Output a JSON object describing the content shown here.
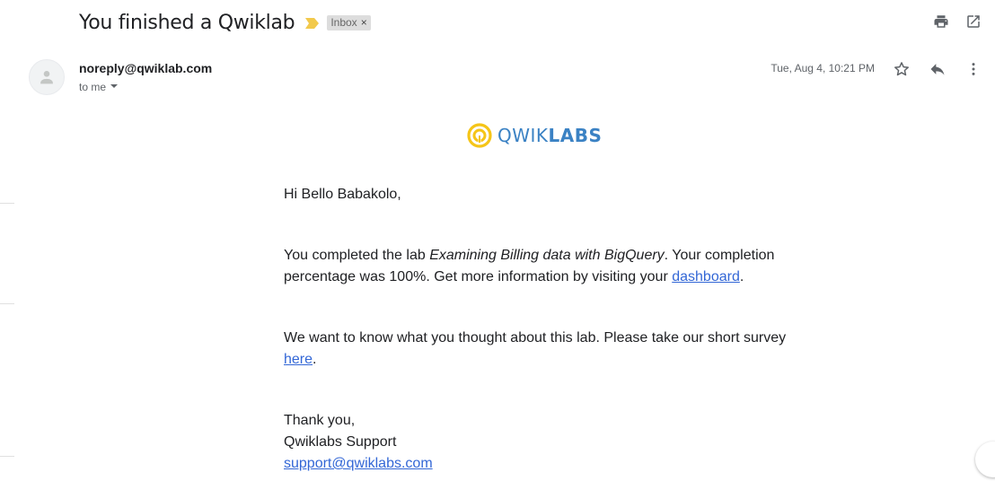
{
  "email": {
    "subject": "You finished a Qwiklab",
    "label": "Inbox",
    "label_close": "×",
    "sender": "noreply@qwiklab.com",
    "to": "to me",
    "date": "Tue, Aug 4, 10:21 PM"
  },
  "icons": {
    "print": "print-icon",
    "open_new_window": "open-in-new-window-icon",
    "importance": "importance-marker-icon",
    "star": "star-icon",
    "reply": "reply-icon",
    "more": "more-vertical-icon",
    "avatar": "avatar-icon",
    "dropdown": "chevron-down-icon",
    "logo": "qwiklabs-logo-icon"
  },
  "logo": {
    "text_light": "QWIK",
    "text_bold": "LABS"
  },
  "body": {
    "greeting": "Hi Bello Babakolo,",
    "p2_before": "You completed the lab ",
    "p2_lab": "Examining Billing data with BigQuery",
    "p2_middle": ". Your completion percentage was 100%. Get more information by visiting your ",
    "p2_link": "dashboard",
    "p2_after": ".",
    "p3_before": "We want to know what you thought about this lab. Please take our short survey ",
    "p3_link": "here",
    "p3_after": ".",
    "signoff": "Thank you,",
    "team": "Qwiklabs Support",
    "support_email": "support@qwiklabs.com"
  },
  "colors": {
    "link": "#3367d6",
    "logo_blue": "#3b82c4",
    "logo_yellow": "#f5c518",
    "importance": "#f2c94c"
  }
}
